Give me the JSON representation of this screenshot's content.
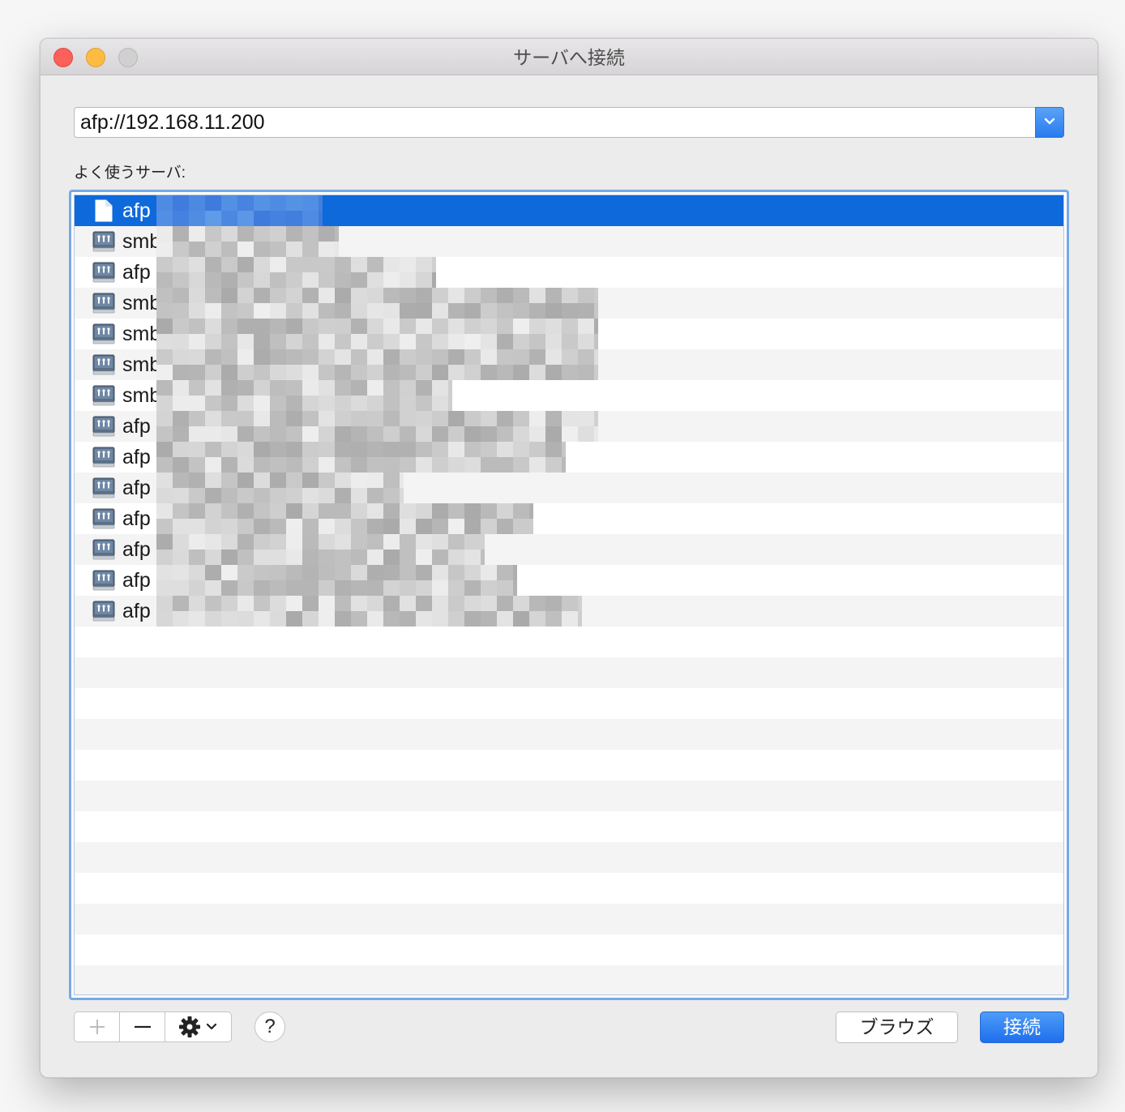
{
  "window": {
    "title": "サーバへ接続"
  },
  "address": {
    "value": "afp://192.168.11.200"
  },
  "favorites": {
    "label": "よく使うサーバ:",
    "items": [
      {
        "protocol": "afp",
        "icon": "document-icon",
        "selected": true
      },
      {
        "protocol": "smb",
        "icon": "network-server-icon",
        "selected": false
      },
      {
        "protocol": "afp",
        "icon": "network-server-icon",
        "selected": false
      },
      {
        "protocol": "smb",
        "icon": "network-server-icon",
        "selected": false
      },
      {
        "protocol": "smb",
        "icon": "network-server-icon",
        "selected": false
      },
      {
        "protocol": "smb",
        "icon": "network-server-icon",
        "selected": false
      },
      {
        "protocol": "smb",
        "icon": "network-server-icon",
        "selected": false
      },
      {
        "protocol": "afp",
        "icon": "network-server-icon",
        "selected": false
      },
      {
        "protocol": "afp",
        "icon": "network-server-icon",
        "selected": false
      },
      {
        "protocol": "afp",
        "icon": "network-server-icon",
        "selected": false
      },
      {
        "protocol": "afp",
        "icon": "network-server-icon",
        "selected": false
      },
      {
        "protocol": "afp",
        "icon": "network-server-icon",
        "selected": false
      },
      {
        "protocol": "afp",
        "icon": "network-server-icon",
        "selected": false
      },
      {
        "protocol": "afp",
        "icon": "network-server-icon",
        "selected": false
      }
    ]
  },
  "toolbar": {
    "add_label": "+",
    "remove_label": "−",
    "gear_icon": "gear-icon",
    "help_label": "?"
  },
  "buttons": {
    "browse_label": "ブラウズ",
    "connect_label": "接続"
  },
  "colors": {
    "selection": "#0e69db",
    "accent": "#2a7bef",
    "close": "#fc605b",
    "minimize": "#fdbc40",
    "zoom_disabled": "#d0d0d0"
  }
}
